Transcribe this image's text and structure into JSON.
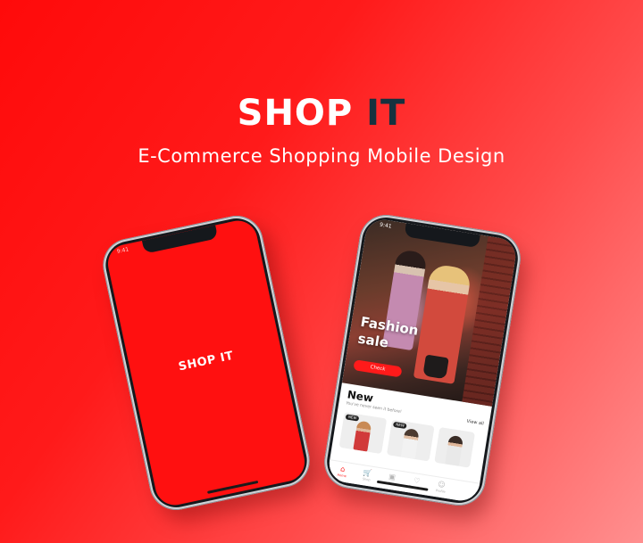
{
  "header": {
    "title_main": "SHOP ",
    "title_accent": "IT",
    "subtitle": "E-Commerce Shopping Mobile Design"
  },
  "colors": {
    "brand_red": "#ff1010",
    "accent_dark": "#16323f",
    "text_white": "#ffffff"
  },
  "phone_left": {
    "status_time": "9:41",
    "splash_logo": "SHOP IT"
  },
  "phone_right": {
    "status_time": "9:41",
    "hero_line1": "Fashion",
    "hero_line2": "sale",
    "check_button": "Check",
    "new_title": "New",
    "new_subtitle": "You've never seen it before!",
    "view_all": "View all",
    "badge_label": "NEW",
    "tabs": [
      {
        "icon": "home-icon",
        "glyph": "⌂",
        "label": "Home",
        "active": true
      },
      {
        "icon": "cart-icon",
        "glyph": "🛒",
        "label": "Shop",
        "active": false
      },
      {
        "icon": "bag-icon",
        "glyph": "▣",
        "label": "Bag",
        "active": false
      },
      {
        "icon": "heart-icon",
        "glyph": "♡",
        "label": "Favorites",
        "active": false
      },
      {
        "icon": "profile-icon",
        "glyph": "☺",
        "label": "Profile",
        "active": false
      }
    ]
  }
}
